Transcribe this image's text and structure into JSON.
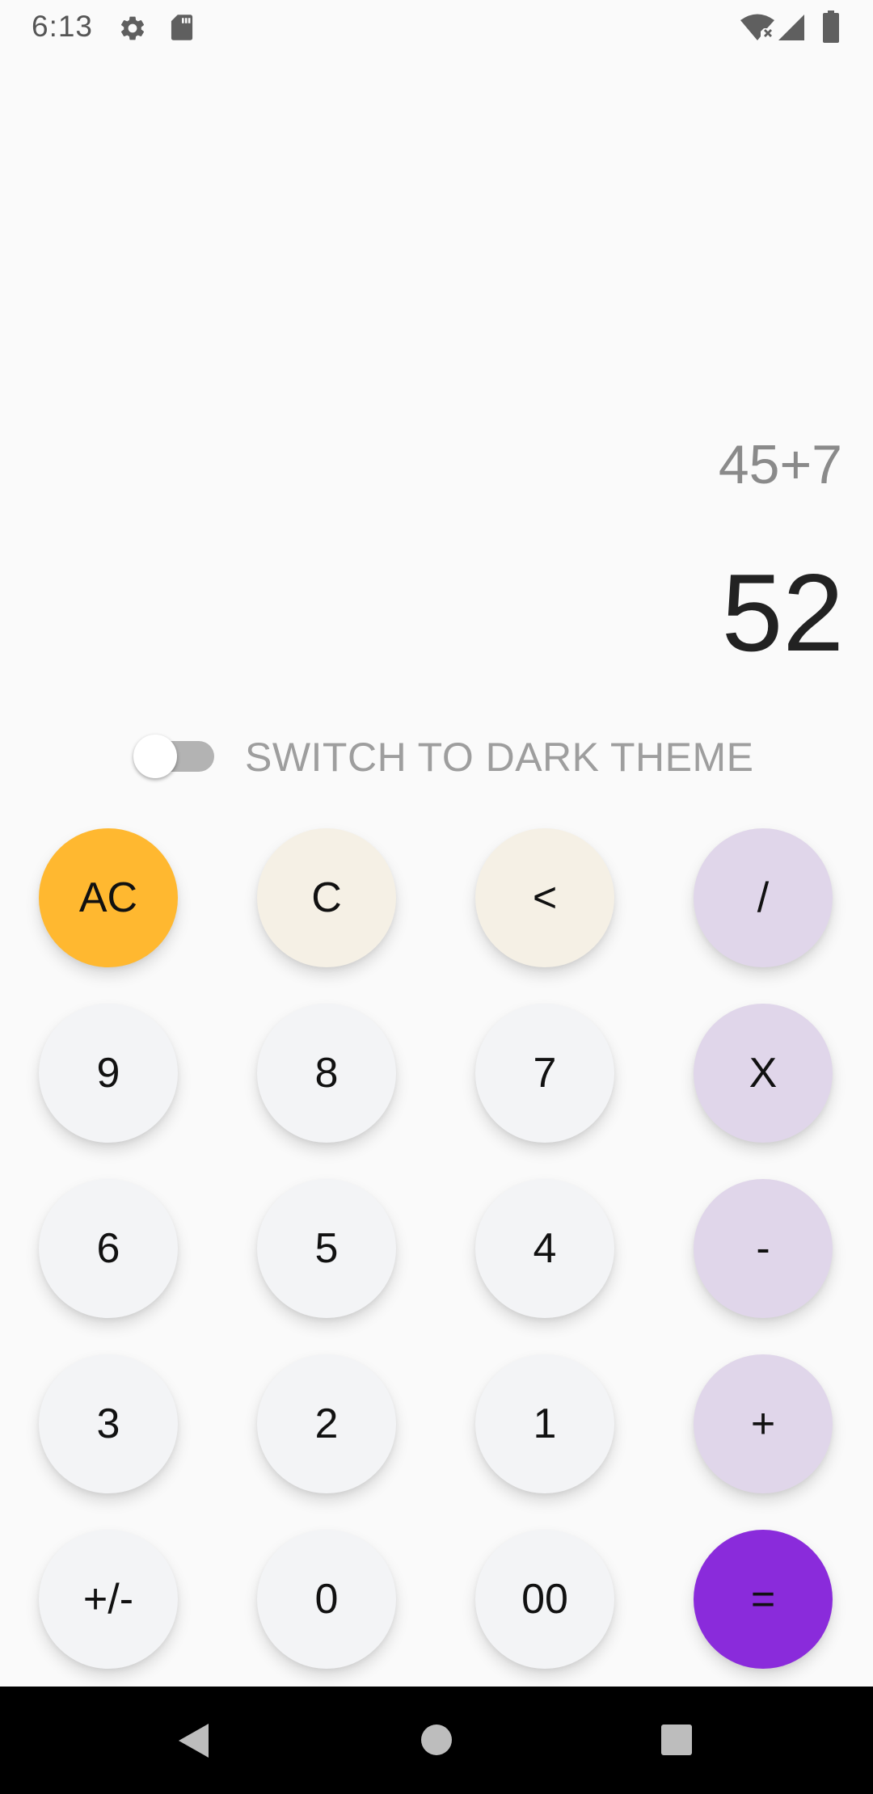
{
  "status_bar": {
    "time": "6:13",
    "left_icons": [
      "settings-gear-icon",
      "sd-card-icon"
    ],
    "right_icons": [
      "wifi-no-internet-icon",
      "cell-signal-icon",
      "battery-icon"
    ]
  },
  "display": {
    "expression": "45+7",
    "result": "52"
  },
  "theme_switch": {
    "label": "SWITCH TO DARK THEME",
    "checked": false
  },
  "keypad": {
    "rows": [
      [
        "AC",
        "C",
        "<",
        "/"
      ],
      [
        "9",
        "8",
        "7",
        "X"
      ],
      [
        "6",
        "5",
        "4",
        "-"
      ],
      [
        "3",
        "2",
        "1",
        "+"
      ],
      [
        "+/-",
        "0",
        "00",
        "="
      ]
    ]
  },
  "colors": {
    "background": "#fafafa",
    "number_key": "#f3f4f6",
    "function_key": "#f5f0e5",
    "operator_key": "#e0d6ea",
    "clear_key": "#ffb830",
    "equals_key": "#8a2bdb",
    "result_text": "#222222",
    "expression_text": "#8a8a8a"
  },
  "nav_bar": {
    "icons": [
      "back-icon",
      "home-icon",
      "recents-icon"
    ]
  }
}
